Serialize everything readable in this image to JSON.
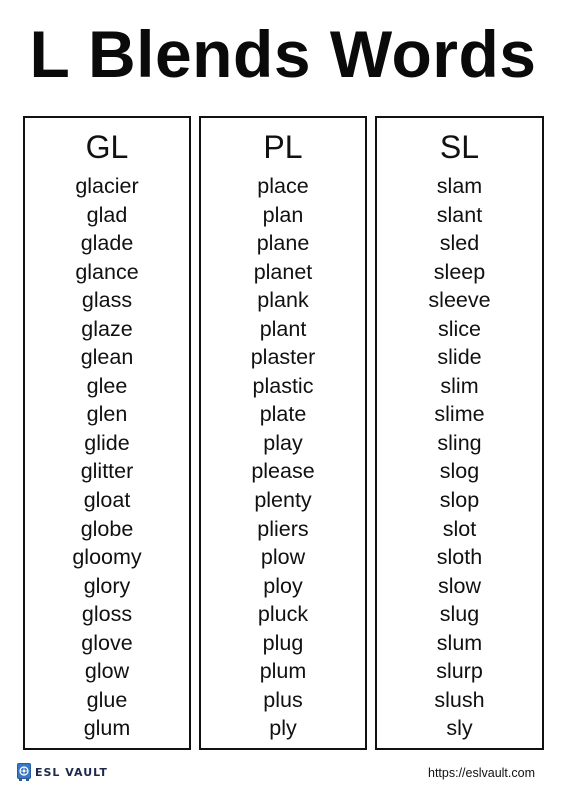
{
  "title": "L Blends Words",
  "columns": [
    {
      "heading": "GL",
      "words": [
        "glacier",
        "glad",
        "glade",
        "glance",
        "glass",
        "glaze",
        "glean",
        "glee",
        "glen",
        "glide",
        "glitter",
        "gloat",
        "globe",
        "gloomy",
        "glory",
        "gloss",
        "glove",
        "glow",
        "glue",
        "glum"
      ]
    },
    {
      "heading": "PL",
      "words": [
        "place",
        "plan",
        "plane",
        "planet",
        "plank",
        "plant",
        "plaster",
        "plastic",
        "plate",
        "play",
        "please",
        "plenty",
        "pliers",
        "plow",
        "ploy",
        "pluck",
        "plug",
        "plum",
        "plus",
        "ply"
      ]
    },
    {
      "heading": "SL",
      "words": [
        "slam",
        "slant",
        "sled",
        "sleep",
        "sleeve",
        "slice",
        "slide",
        "slim",
        "slime",
        "sling",
        "slog",
        "slop",
        "slot",
        "sloth",
        "slow",
        "slug",
        "slum",
        "slurp",
        "slush",
        "sly"
      ]
    }
  ],
  "footer": {
    "brand": "ESL VAULT",
    "brand_icon": "vault-icon",
    "url": "https://eslvault.com",
    "brand_color": "#1f2a4a",
    "icon_color": "#3a78c4"
  }
}
